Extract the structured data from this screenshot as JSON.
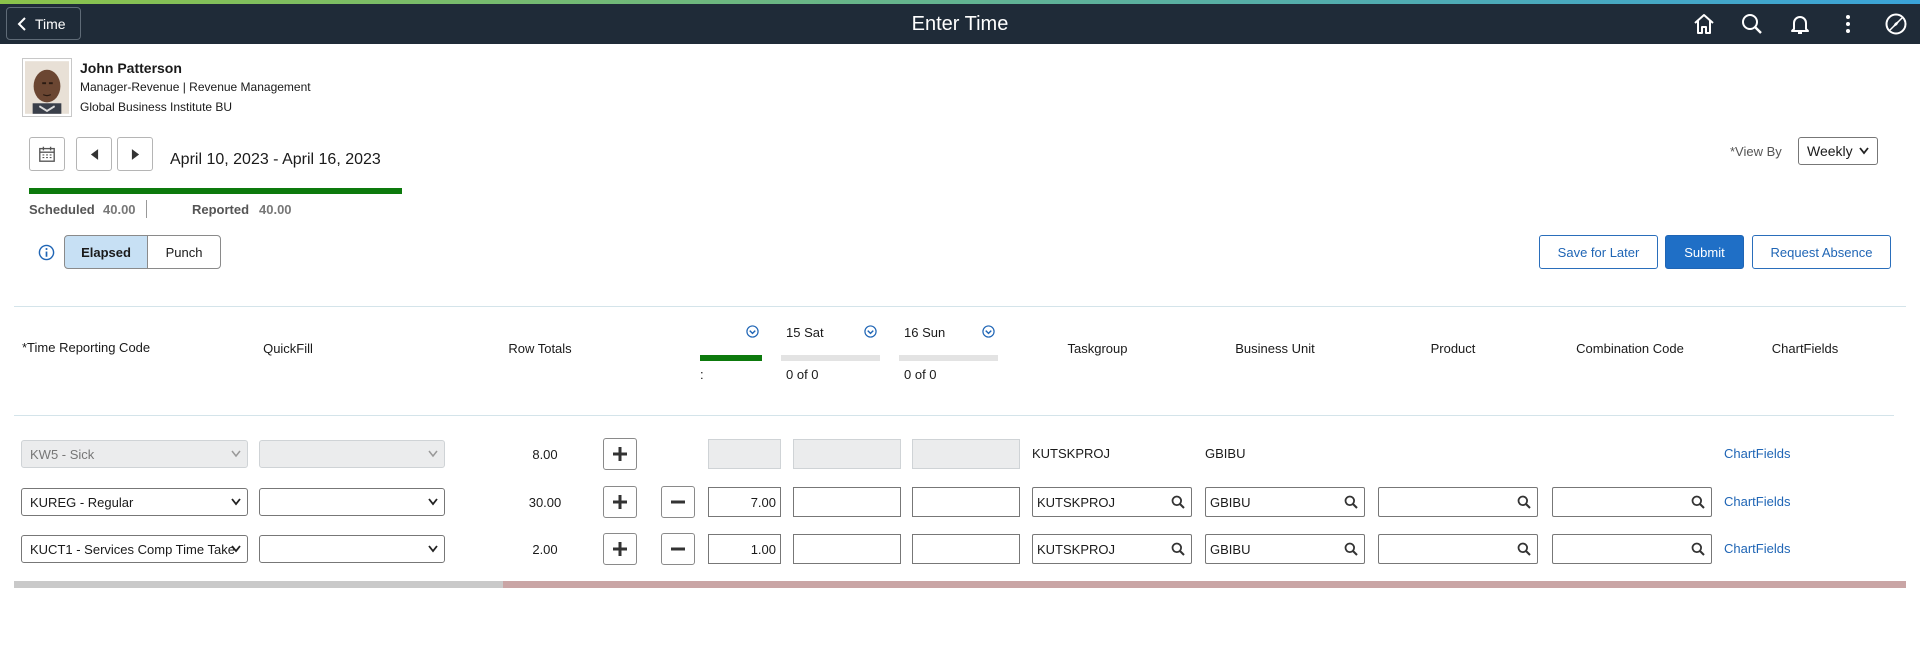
{
  "header": {
    "back_label": "Time",
    "title": "Enter Time",
    "icons": [
      "home-icon",
      "search-icon",
      "notification-icon",
      "actions-menu-icon",
      "navbar-icon"
    ]
  },
  "employee": {
    "name": "John Patterson",
    "job": "Manager-Revenue | Revenue Management",
    "business_unit": "Global Business Institute BU"
  },
  "period": {
    "range": "April 10, 2023 - April 16, 2023",
    "view_by_label": "*View By",
    "view_by_value": "Weekly"
  },
  "summary": {
    "scheduled_label": "Scheduled",
    "scheduled_value": "40.00",
    "reported_label": "Reported",
    "reported_value": "40.00",
    "reported_fraction": 1.0
  },
  "mode": {
    "elapsed_label": "Elapsed",
    "punch_label": "Punch",
    "selected": "Elapsed"
  },
  "actions": {
    "save_later": "Save for Later",
    "submit": "Submit",
    "request_absence": "Request Absence"
  },
  "columns": {
    "trc": "*Time Reporting Code",
    "quickfill": "QuickFill",
    "row_totals": "Row Totals",
    "taskgroup": "Taskgroup",
    "business_unit": "Business Unit",
    "product": "Product",
    "combination_code": "Combination Code",
    "chartfields": "ChartFields"
  },
  "days": [
    {
      "label": "",
      "count": ":",
      "fraction": 1.0
    },
    {
      "label": "15 Sat",
      "count": "0 of 0",
      "fraction": 0
    },
    {
      "label": "16 Sun",
      "count": "0 of 0",
      "fraction": 0
    }
  ],
  "rows": [
    {
      "trc": "KW5 - Sick",
      "quickfill": "",
      "total": "8.00",
      "hours": [
        "",
        "",
        ""
      ],
      "taskgroup": "KUTSKPROJ",
      "bu": "GBIBU",
      "product": "",
      "combo": "",
      "chartfields": "ChartFields",
      "readonly": true
    },
    {
      "trc": "KUREG - Regular",
      "quickfill": "",
      "total": "30.00",
      "hours": [
        "7.00",
        "",
        ""
      ],
      "taskgroup": "KUTSKPROJ",
      "bu": "GBIBU",
      "product": "",
      "combo": "",
      "chartfields": "ChartFields",
      "readonly": false
    },
    {
      "trc": "KUCT1 - Services Comp Time Take",
      "quickfill": "",
      "total": "2.00",
      "hours": [
        "1.00",
        "",
        ""
      ],
      "taskgroup": "KUTSKPROJ",
      "bu": "GBIBU",
      "product": "",
      "combo": "",
      "chartfields": "ChartFields",
      "readonly": false
    }
  ],
  "colors": {
    "banner": "#1f2b38",
    "progress": "#0d7a0d",
    "primary": "#1f6fc6",
    "selected_segment": "#c7e0f4",
    "link": "#1f65b5"
  }
}
